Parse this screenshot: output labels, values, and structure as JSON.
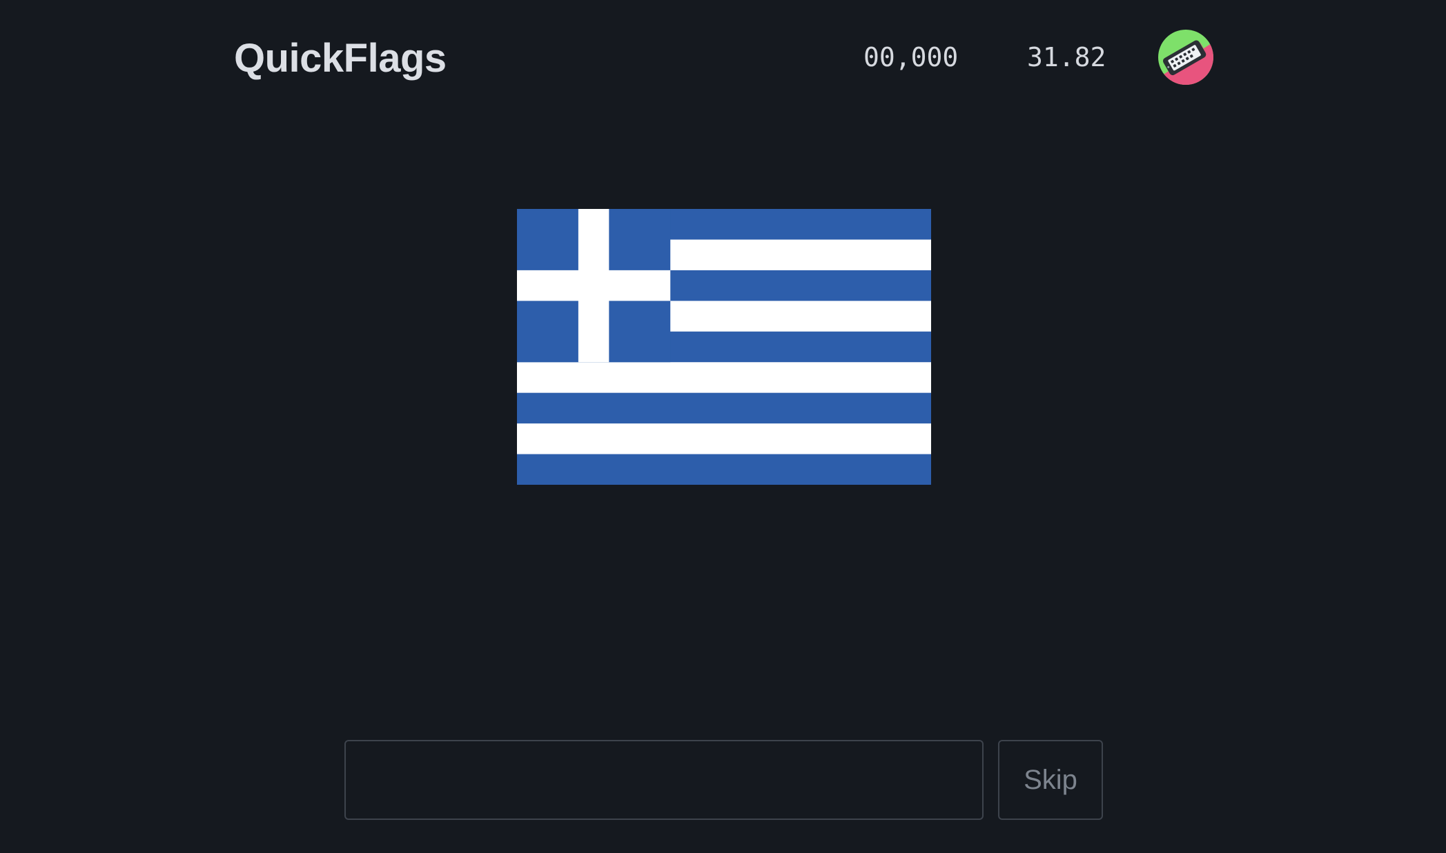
{
  "header": {
    "app_title": "QuickFlags",
    "score": "00,000",
    "timer": "31.82"
  },
  "avatar": {
    "icon": "mobile-phone-icon",
    "colors": {
      "top": "#7ee06a",
      "bottom": "#e8547e",
      "device": "#2b2f35"
    }
  },
  "flag": {
    "icon": "greece-flag",
    "colors": {
      "blue": "#2d5eab",
      "white": "#ffffff"
    }
  },
  "answer": {
    "value": "",
    "placeholder": ""
  },
  "skip_label": "Skip",
  "colors": {
    "background": "#15191f",
    "border": "#3d434c",
    "title": "#dcdfe5",
    "skip_text": "#7d848e"
  }
}
